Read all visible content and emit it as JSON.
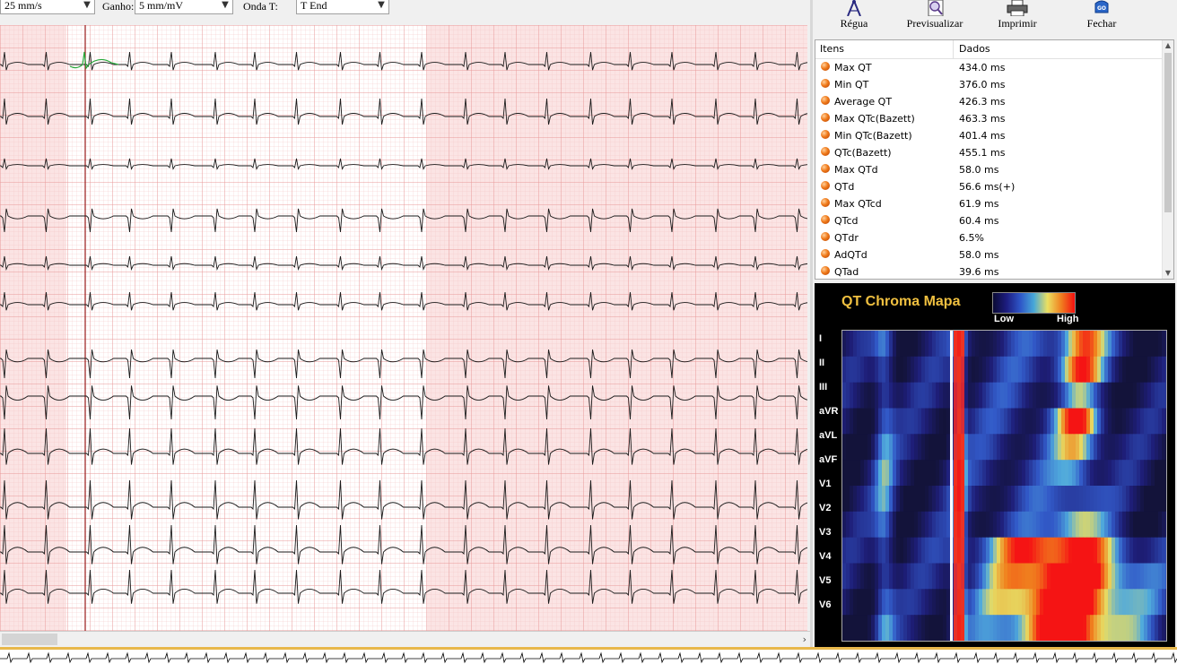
{
  "toolbar_top": {
    "speed_value": "25  mm/s",
    "gain_label": "Ganho:",
    "gain_value": "5 mm/mV",
    "onda_label": "Onda T:",
    "onda_value": "T End"
  },
  "tools": [
    {
      "label": "Régua",
      "icon": "ruler-icon"
    },
    {
      "label": "Previsualizar",
      "icon": "preview-icon"
    },
    {
      "label": "Imprimir",
      "icon": "printer-icon"
    },
    {
      "label": "Fechar",
      "icon": "close-icon"
    }
  ],
  "table": {
    "col_items": "Itens",
    "col_data": "Dados",
    "rows": [
      {
        "k": "Max QT",
        "v": "434.0 ms"
      },
      {
        "k": "Min QT",
        "v": "376.0 ms"
      },
      {
        "k": "Average QT",
        "v": "426.3 ms"
      },
      {
        "k": "Max QTc(Bazett)",
        "v": "463.3 ms"
      },
      {
        "k": "Min QTc(Bazett)",
        "v": "401.4 ms"
      },
      {
        "k": "QTc(Bazett)",
        "v": "455.1 ms"
      },
      {
        "k": "Max QTd",
        "v": "58.0 ms"
      },
      {
        "k": "QTd",
        "v": "56.6 ms(+)"
      },
      {
        "k": "Max QTcd",
        "v": "61.9 ms"
      },
      {
        "k": "QTcd",
        "v": "60.4 ms"
      },
      {
        "k": "QTdr",
        "v": "6.5%"
      },
      {
        "k": "AdQTd",
        "v": "58.0 ms"
      },
      {
        "k": "QTad",
        "v": "39.6 ms"
      }
    ]
  },
  "chroma": {
    "title": "QT Chroma Mapa",
    "low_label": "Low",
    "high_label": "High",
    "leads": [
      "I",
      "II",
      "III",
      "aVR",
      "aVL",
      "aVF",
      "V1",
      "V2",
      "V3",
      "V4",
      "V5",
      "V6"
    ]
  },
  "colors": {
    "ecg_grid_pink": "#f8d6d6",
    "status_border": "#e8b84b",
    "chroma_title": "#f0c040"
  }
}
